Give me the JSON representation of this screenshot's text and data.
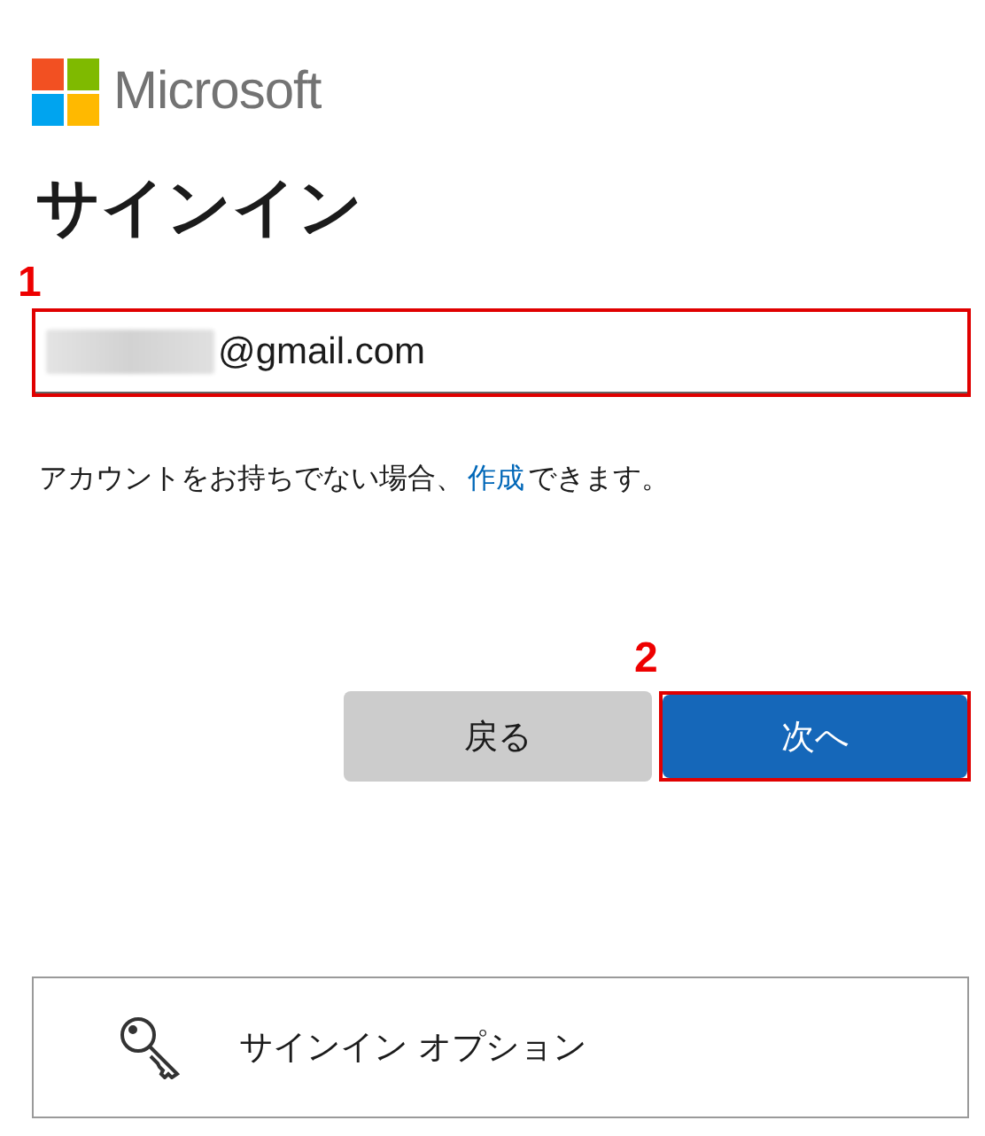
{
  "logo": {
    "text": "Microsoft"
  },
  "title": "サインイン",
  "email_field": {
    "value": "@gmail.com",
    "redacted": true,
    "annotation": "1"
  },
  "no_account": {
    "text": "アカウントをお持ちでない場合、",
    "link": "作成",
    "suffix": "できます。"
  },
  "buttons": [
    {
      "label": "戻る",
      "kind": "secondary"
    },
    {
      "label": "次へ",
      "kind": "primary",
      "annotation": "2"
    }
  ],
  "sign_in_options": {
    "label": "サインイン オプション"
  }
}
